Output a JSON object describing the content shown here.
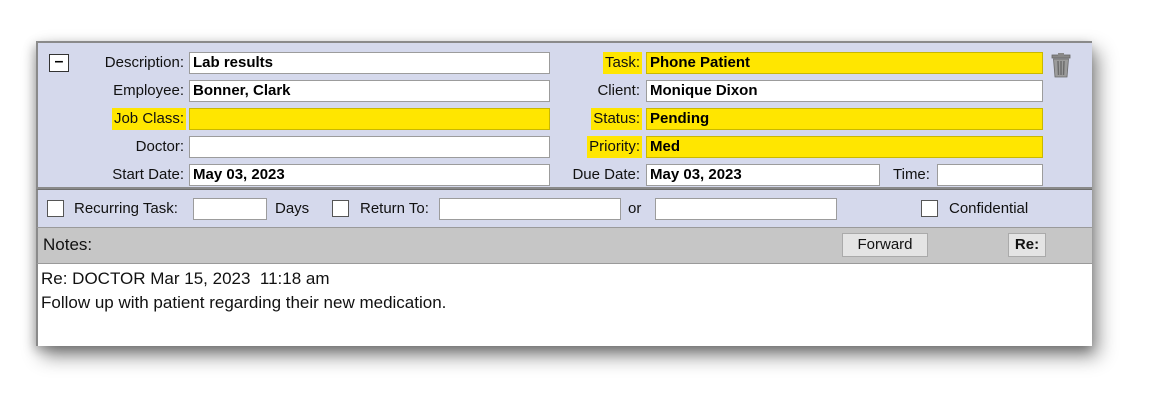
{
  "form": {
    "collapse_symbol": "–",
    "description_label": "Description:",
    "description_value": "Lab results",
    "employee_label": "Employee:",
    "employee_value": "Bonner, Clark",
    "job_class_label": "Job Class:",
    "job_class_value": "",
    "doctor_label": "Doctor:",
    "doctor_value": "",
    "start_date_label": "Start Date:",
    "start_date_value": "May 03, 2023",
    "task_label": "Task:",
    "task_value": "Phone Patient",
    "client_label": "Client:",
    "client_value": "Monique Dixon",
    "status_label": "Status:",
    "status_value": "Pending",
    "priority_label": "Priority:",
    "priority_value": "Med",
    "due_date_label": "Due Date:",
    "due_date_value": "May 03, 2023",
    "time_label": "Time:",
    "time_value": "",
    "trash_icon": "trash-icon"
  },
  "options": {
    "recurring_label": "Recurring Task:",
    "recurring_value": "",
    "days_label": "Days",
    "return_to_label": "Return To:",
    "return_to_value": "",
    "or_label": "or",
    "or_value": "",
    "confidential_label": "Confidential"
  },
  "notes": {
    "label": "Notes:",
    "forward_button": "Forward",
    "reply_button": "Re:",
    "lines": [
      "Re: DOCTOR Mar 15, 2023  11:18 am",
      "Follow up with patient regarding their new medication."
    ]
  },
  "colors": {
    "highlight": "#ffe600",
    "panel_bg": "#d5d9ec",
    "notes_bar_bg": "#c6c6c6"
  }
}
